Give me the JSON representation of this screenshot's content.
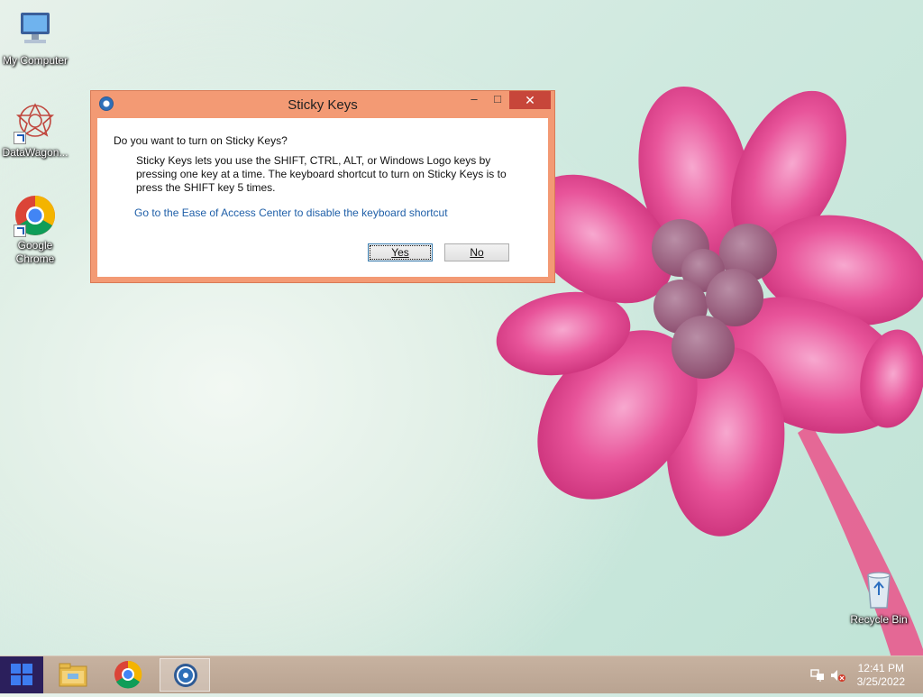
{
  "desktop": {
    "icons": [
      {
        "label": "My Computer"
      },
      {
        "label": "DataWagon..."
      },
      {
        "label": "Google\nChrome"
      },
      {
        "label": "Recycle Bin"
      }
    ]
  },
  "dialog": {
    "title": "Sticky Keys",
    "question": "Do you want to turn on Sticky Keys?",
    "description": "Sticky Keys lets you use the SHIFT, CTRL, ALT, or Windows Logo keys by pressing one key at a time. The keyboard shortcut to turn on Sticky Keys is to press the SHIFT key 5 times.",
    "link": "Go to the Ease of Access Center to disable the keyboard shortcut",
    "yes_label": "Yes",
    "no_label": "No",
    "minimize_glyph": "–",
    "maximize_glyph": "□",
    "close_glyph": "✕"
  },
  "taskbar": {
    "time": "12:41 PM",
    "date": "3/25/2022"
  },
  "colors": {
    "dialog_frame": "#f39a74",
    "close_button": "#c7463a",
    "link": "#1f5fa8",
    "taskbar": "#bfa997",
    "start_button": "#2b1f5c"
  }
}
